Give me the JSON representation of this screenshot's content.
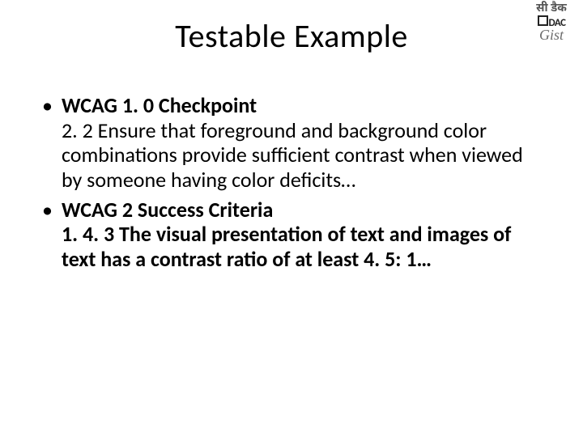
{
  "title": "Testable Example",
  "logo": {
    "line1": "सी डैक",
    "line2_text": "DAC",
    "line3": "Gist"
  },
  "bullets": [
    {
      "heading": "WCAG 1. 0 Checkpoint",
      "body": "2. 2 Ensure that foreground and background color combinations provide sufficient contrast when viewed by someone having color deficits…",
      "body_bold": false
    },
    {
      "heading": "WCAG 2 Success Criteria",
      "body": "1. 4. 3 The visual presentation of text and images of text has a contrast ratio of at least 4. 5: 1…",
      "body_bold": true
    }
  ]
}
